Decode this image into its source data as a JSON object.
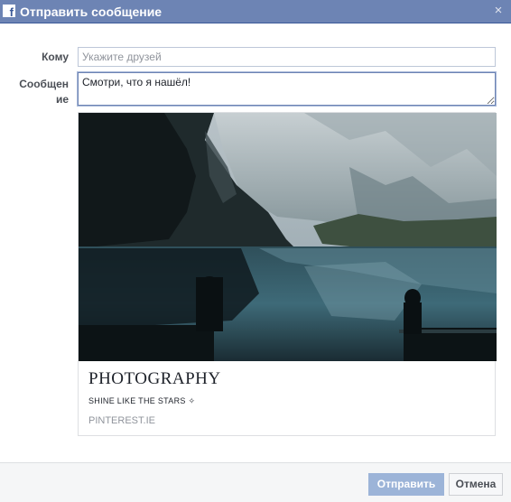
{
  "dialog": {
    "title": "Отправить сообщение",
    "close_glyph": "×",
    "logo_letter": "f"
  },
  "form": {
    "to_label": "Кому",
    "to_placeholder": "Укажите друзей",
    "to_value": "",
    "message_label_line1": "Сообщен",
    "message_label_line2": "ие",
    "message_value": "Смотри, что я нашёл!"
  },
  "card": {
    "title": "PHOTOGRAPHY",
    "description": "SHINE LIKE THE STARS ✧",
    "source": "PINTEREST.IE"
  },
  "footer": {
    "send_label": "Отправить",
    "cancel_label": "Отмена"
  },
  "colors": {
    "titlebar": "#6d84b4",
    "send_button": "#9cb4d8",
    "footer_bg": "#f5f6f7"
  },
  "icons": {
    "logo": "facebook-icon",
    "close": "close-icon"
  }
}
